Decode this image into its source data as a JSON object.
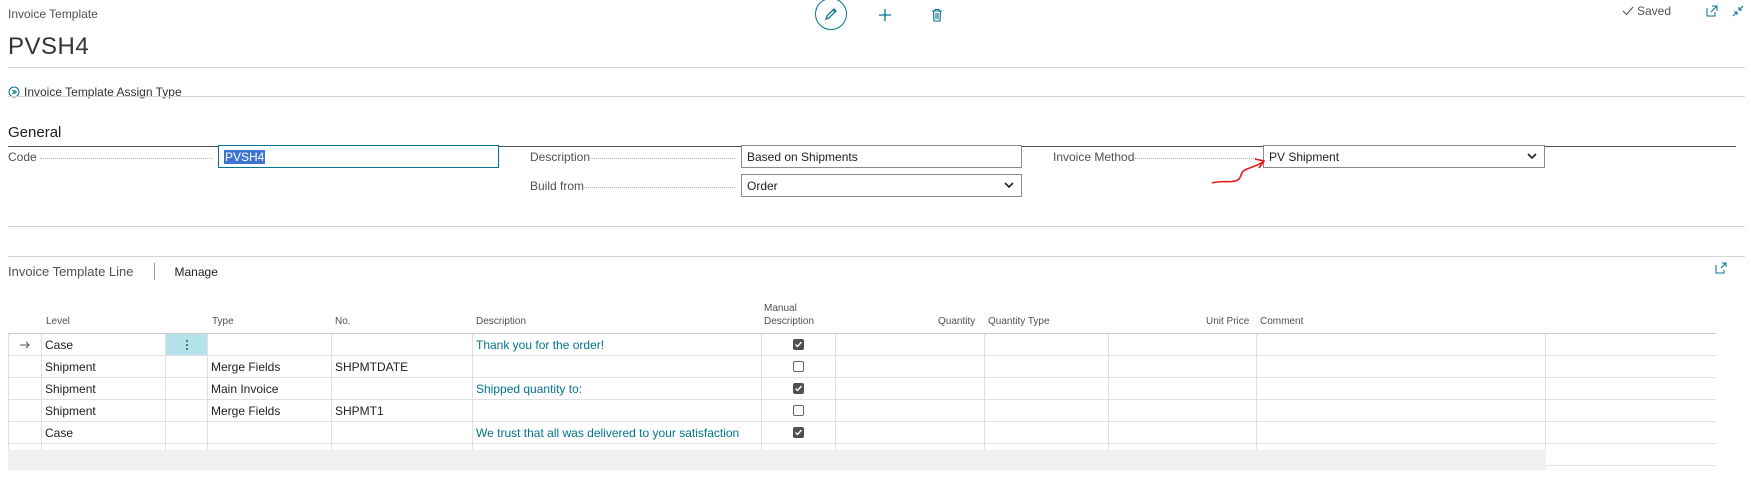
{
  "header": {
    "caption": "Invoice Template",
    "title": "PVSH4",
    "saved_label": "Saved"
  },
  "toolbar": {
    "edit_icon": "pencil-icon",
    "new_icon": "plus-icon",
    "delete_icon": "trash-icon"
  },
  "actions": {
    "assign_type": "Invoice Template Assign Type"
  },
  "general": {
    "title": "General",
    "code_label": "Code",
    "code_value": "PVSH4",
    "description_label": "Description",
    "description_value": "Based on Shipments",
    "build_from_label": "Build from",
    "build_from_value": "Order",
    "invoice_method_label": "Invoice Method",
    "invoice_method_value": "PV Shipment"
  },
  "lines": {
    "title": "Invoice Template Line",
    "manage_label": "Manage",
    "columns": {
      "level": "Level",
      "type": "Type",
      "no": "No.",
      "description": "Description",
      "manual_description_1": "Manual",
      "manual_description_2": "Description",
      "quantity": "Quantity",
      "quantity_type": "Quantity Type",
      "unit_price": "Unit Price",
      "comment": "Comment"
    },
    "rows": [
      {
        "level": "Case",
        "type": "",
        "no": "",
        "description": "Thank you for the order!",
        "manual": true
      },
      {
        "level": "Shipment",
        "type": "Merge Fields",
        "no": "SHPMTDATE",
        "description": "",
        "manual": false
      },
      {
        "level": "Shipment",
        "type": "Main Invoice",
        "no": "",
        "description": "Shipped quantity to:",
        "manual": true
      },
      {
        "level": "Shipment",
        "type": "Merge Fields",
        "no": "SHPMT1",
        "description": "",
        "manual": false
      },
      {
        "level": "Case",
        "type": "",
        "no": "",
        "description": "We trust that all was delivered to your satisfaction",
        "manual": true
      }
    ]
  },
  "colors": {
    "accent": "#00748f",
    "annotation": "#e8191a"
  }
}
